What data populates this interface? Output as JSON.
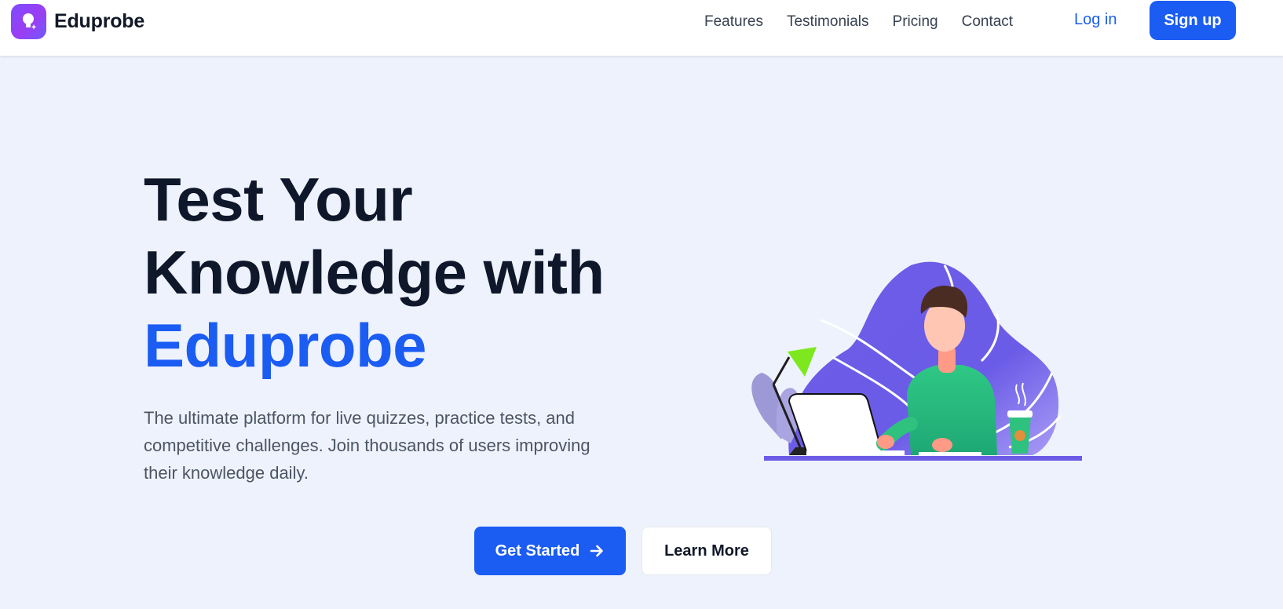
{
  "brand": {
    "name": "Eduprobe",
    "logo_icon": "lightbulb-sparkle-icon"
  },
  "nav": {
    "links": [
      "Features",
      "Testimonials",
      "Pricing",
      "Contact"
    ],
    "login": "Log in",
    "signup": "Sign up"
  },
  "hero": {
    "title_line1": "Test Your",
    "title_line2": "Knowledge with",
    "title_accent": "Eduprobe",
    "subtitle": "The ultimate platform for live quizzes, practice tests, and competitive challenges. Join thousands of users improving their knowledge daily.",
    "primary_cta": "Get Started",
    "primary_cta_icon": "arrow-right-icon",
    "secondary_cta": "Learn More"
  },
  "colors": {
    "accent": "#1b5cf3",
    "background": "#eef2fc",
    "heading": "#0f172a",
    "illustration_blob": "#6b5ce7",
    "shirt": "#2ec27e",
    "lamp": "#7ee81f"
  }
}
